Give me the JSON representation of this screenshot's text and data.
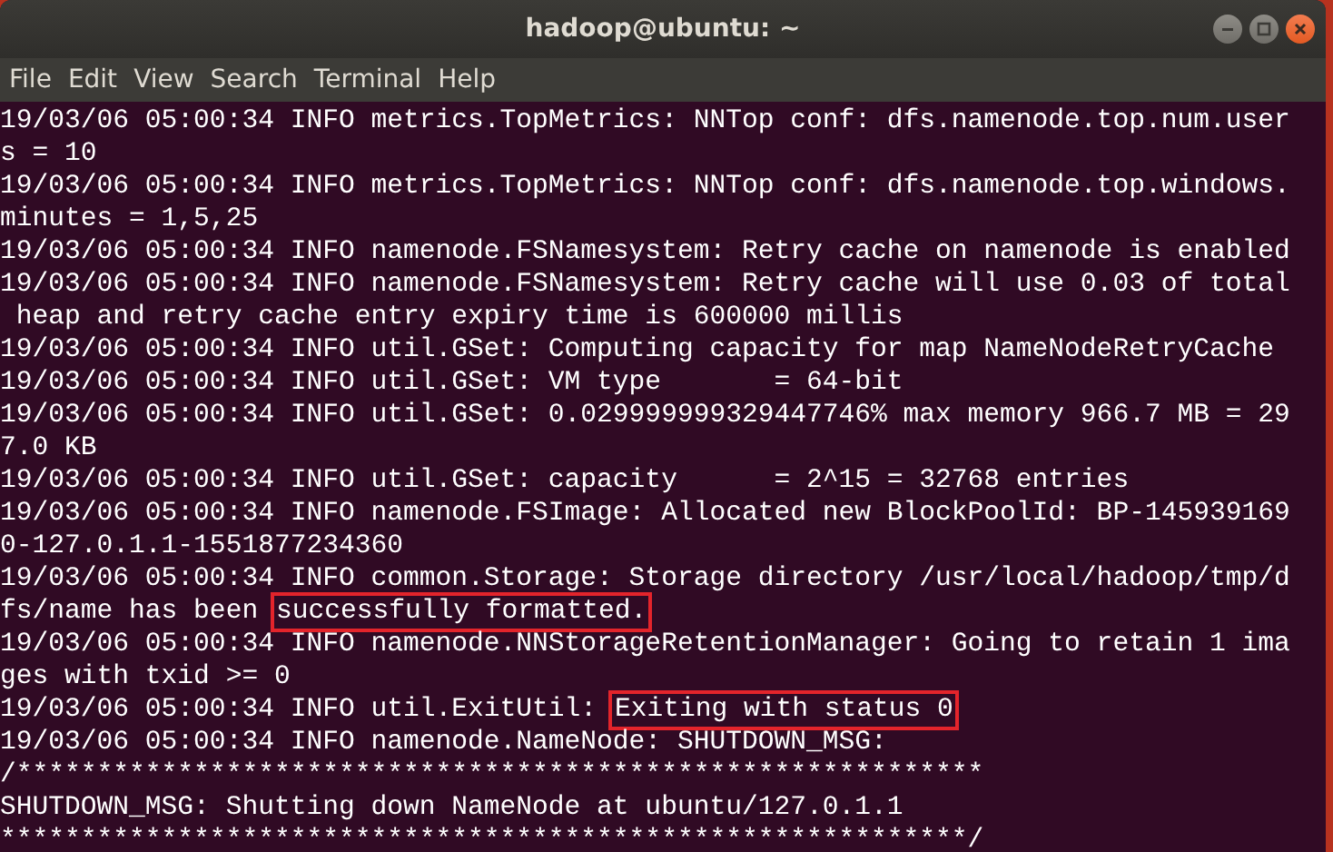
{
  "window": {
    "title": "hadoop@ubuntu: ~"
  },
  "menu": [
    "File",
    "Edit",
    "View",
    "Search",
    "Terminal",
    "Help"
  ],
  "terminal_lines": [
    [
      {
        "text": "19/03/06 05:00:34 INFO metrics.TopMetrics: NNTop conf: dfs.namenode.top.num.user",
        "highlighted": false
      }
    ],
    [
      {
        "text": "s = 10",
        "highlighted": false
      }
    ],
    [
      {
        "text": "19/03/06 05:00:34 INFO metrics.TopMetrics: NNTop conf: dfs.namenode.top.windows.",
        "highlighted": false
      }
    ],
    [
      {
        "text": "minutes = 1,5,25",
        "highlighted": false
      }
    ],
    [
      {
        "text": "19/03/06 05:00:34 INFO namenode.FSNamesystem: Retry cache on namenode is enabled",
        "highlighted": false
      }
    ],
    [
      {
        "text": "19/03/06 05:00:34 INFO namenode.FSNamesystem: Retry cache will use 0.03 of total",
        "highlighted": false
      }
    ],
    [
      {
        "text": " heap and retry cache entry expiry time is 600000 millis",
        "highlighted": false
      }
    ],
    [
      {
        "text": "19/03/06 05:00:34 INFO util.GSet: Computing capacity for map NameNodeRetryCache",
        "highlighted": false
      }
    ],
    [
      {
        "text": "19/03/06 05:00:34 INFO util.GSet: VM type       = 64-bit",
        "highlighted": false
      }
    ],
    [
      {
        "text": "19/03/06 05:00:34 INFO util.GSet: 0.029999999329447746% max memory 966.7 MB = 29",
        "highlighted": false
      }
    ],
    [
      {
        "text": "7.0 KB",
        "highlighted": false
      }
    ],
    [
      {
        "text": "19/03/06 05:00:34 INFO util.GSet: capacity      = 2^15 = 32768 entries",
        "highlighted": false
      }
    ],
    [
      {
        "text": "19/03/06 05:00:34 INFO namenode.FSImage: Allocated new BlockPoolId: BP-145939169",
        "highlighted": false
      }
    ],
    [
      {
        "text": "0-127.0.1.1-1551877234360",
        "highlighted": false
      }
    ],
    [
      {
        "text": "19/03/06 05:00:34 INFO common.Storage: Storage directory /usr/local/hadoop/tmp/d",
        "highlighted": false
      }
    ],
    [
      {
        "text": "fs/name has been ",
        "highlighted": false
      },
      {
        "text": "successfully formatted.",
        "highlighted": true
      }
    ],
    [
      {
        "text": "19/03/06 05:00:34 INFO namenode.NNStorageRetentionManager: Going to retain 1 ima",
        "highlighted": false
      }
    ],
    [
      {
        "text": "ges with txid >= 0",
        "highlighted": false
      }
    ],
    [
      {
        "text": "19/03/06 05:00:34 INFO util.ExitUtil: ",
        "highlighted": false
      },
      {
        "text": "Exiting with status 0",
        "highlighted": true
      }
    ],
    [
      {
        "text": "19/03/06 05:00:34 INFO namenode.NameNode: SHUTDOWN_MSG:",
        "highlighted": false
      }
    ],
    [
      {
        "text": "/************************************************************",
        "highlighted": false
      }
    ],
    [
      {
        "text": "SHUTDOWN_MSG: Shutting down NameNode at ubuntu/127.0.1.1",
        "highlighted": false
      }
    ],
    [
      {
        "text": "************************************************************/",
        "highlighted": false
      }
    ]
  ]
}
